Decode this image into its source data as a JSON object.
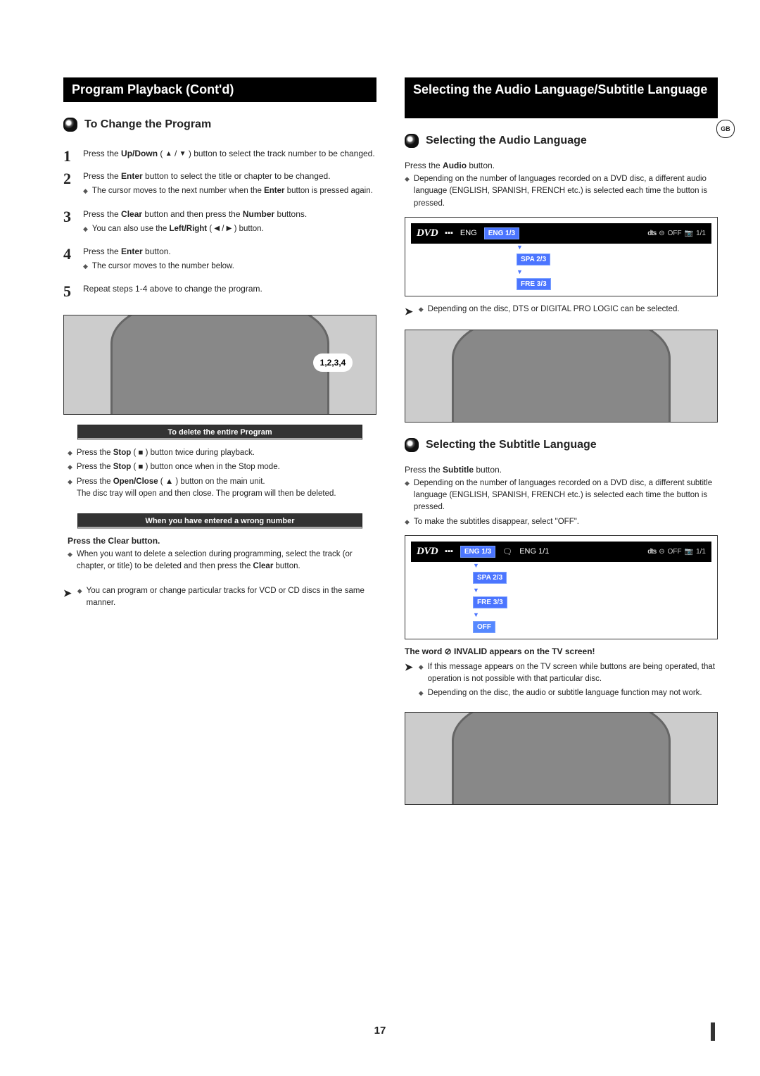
{
  "left": {
    "header": "Program Playback (Cont'd)",
    "section1_title": "To Change the Program",
    "steps": {
      "s1": {
        "text": "Press the Up/Down ( ▲ / ▼ ) button to select the track number to be changed.",
        "bold1": "Up/Down"
      },
      "s2": {
        "text": "Press the Enter button to select the title or chapter to be changed.",
        "note": "The cursor moves to the next number when the Enter button is pressed again.",
        "bold1": "Enter",
        "bold2": "Enter"
      },
      "s3": {
        "text": "Press the Clear button and then press the Number buttons.",
        "note": "You can also use the Left/Right ( ◀ / ▶ ) button.",
        "bold1": "Clear",
        "bold2": "Number",
        "noteBold": "Left/Right"
      },
      "s4": {
        "text": "Press the Enter button.",
        "note": "The cursor moves to the number below.",
        "bold1": "Enter"
      },
      "s5": {
        "text": "Repeat steps 1-4 above to change the program."
      }
    },
    "callout": "1,2,3,4",
    "noteBar1": "To delete the entire Program",
    "delete_block": {
      "l1": "Press the Stop ( ■ ) button twice during playback.",
      "l2": "Press the Stop ( ■ ) button once when in the Stop mode.",
      "l3a": "Press the Open/Close ( ▲ ) button on the main unit.",
      "l3b": "The disc tray will open and then close. The program will then be deleted.",
      "bold_stop": "Stop",
      "bold_open": "Open/Close"
    },
    "noteBar2": "When you have entered a wrong number",
    "clear_title": "Press the Clear button.",
    "clear_note": "When you want to delete a selection during programming, select the track (or chapter, or title) to be deleted and then press the Clear button.",
    "clear_bold": "Clear",
    "vcd_note": "You can program or change particular tracks for VCD or CD discs in the same manner."
  },
  "right": {
    "header": "Selecting the Audio Language/Subtitle Language",
    "gb_badge": "GB",
    "audio_title": "Selecting the Audio Language",
    "audio_press": "Press the Audio button.",
    "audio_bold": "Audio",
    "audio_note": "Depending on the number of languages recorded on a DVD disc, a different audio language (ENGLISH, SPANISH, FRENCH etc.) is selected each time the button is pressed.",
    "osd_audio": {
      "eng": "ENG",
      "eng13": "ENG 1/3",
      "spa23": "SPA 2/3",
      "fre33": "FRE 3/3",
      "off": "OFF",
      "right11": "1/1"
    },
    "dolby_note": "Depending on the disc, DTS or DIGITAL PRO LOGIC can be selected.",
    "sub_title": "Selecting the Subtitle Language",
    "sub_press": "Press the Subtitle button.",
    "sub_bold": "Subtitle",
    "sub_note1": "Depending on the number of languages recorded on a DVD disc, a different subtitle language (ENGLISH, SPANISH, FRENCH etc.) is selected each time the button is pressed.",
    "sub_note2": "To make the subtitles disappear, select \"OFF\".",
    "osd_sub": {
      "eng13": "ENG 1/3",
      "eng11": "ENG 1/1",
      "spa23": "SPA 2/3",
      "fre33": "FRE 3/3",
      "off_tag": "OFF",
      "right11": "1/1",
      "off_label": "OFF"
    },
    "invalid_title": "The word ⊘ INVALID appears on the TV screen!",
    "invalid_note1": "If this message appears on the TV screen while buttons are being operated, that operation is not possible with that particular disc.",
    "invalid_note2": "Depending on the disc, the audio or subtitle language function may not work."
  },
  "page_number": "17"
}
